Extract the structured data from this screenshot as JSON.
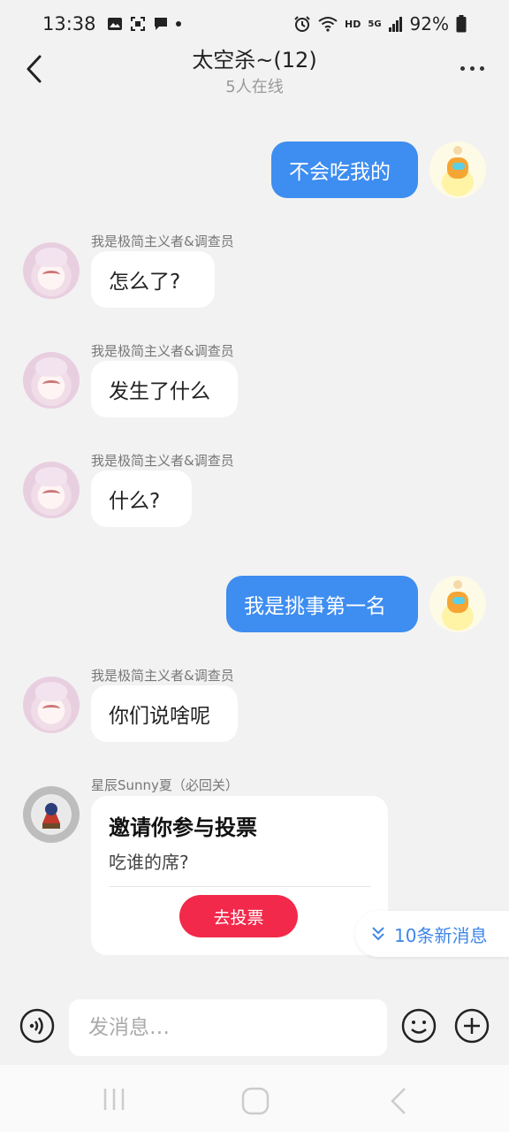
{
  "status_bar": {
    "time": "13:38",
    "network": "HD",
    "signal_label": "5G",
    "battery": "92%"
  },
  "header": {
    "title": "太空杀~(12)",
    "subtitle": "5人在线"
  },
  "messages": [
    {
      "side": "out",
      "text": "不会吃我的"
    },
    {
      "side": "in",
      "sender": "我是极简主义者&调查员",
      "text": "怎么了?"
    },
    {
      "side": "in",
      "sender": "我是极简主义者&调查员",
      "text": "发生了什么"
    },
    {
      "side": "in",
      "sender": "我是极简主义者&调查员",
      "text": "什么?"
    },
    {
      "side": "out",
      "text": "我是挑事第一名"
    },
    {
      "side": "in",
      "sender": "我是极简主义者&调查员",
      "text": "你们说啥呢"
    },
    {
      "side": "in",
      "sender": "星辰Sunny夏（必回关）",
      "type": "vote",
      "vote_title": "邀请你参与投票",
      "vote_question": "吃谁的席?",
      "vote_button": "去投票"
    }
  ],
  "new_messages_pill": "10条新消息",
  "input_bar": {
    "placeholder": "发消息…"
  },
  "colors": {
    "accent_blue": "#3e8df0",
    "vote_red": "#f2294b",
    "background": "#f2f2f2"
  },
  "icons": {
    "back": "back-chevron-icon",
    "more": "more-dots-icon",
    "voice": "voice-icon",
    "emoji": "emoji-icon",
    "plus": "plus-icon"
  }
}
